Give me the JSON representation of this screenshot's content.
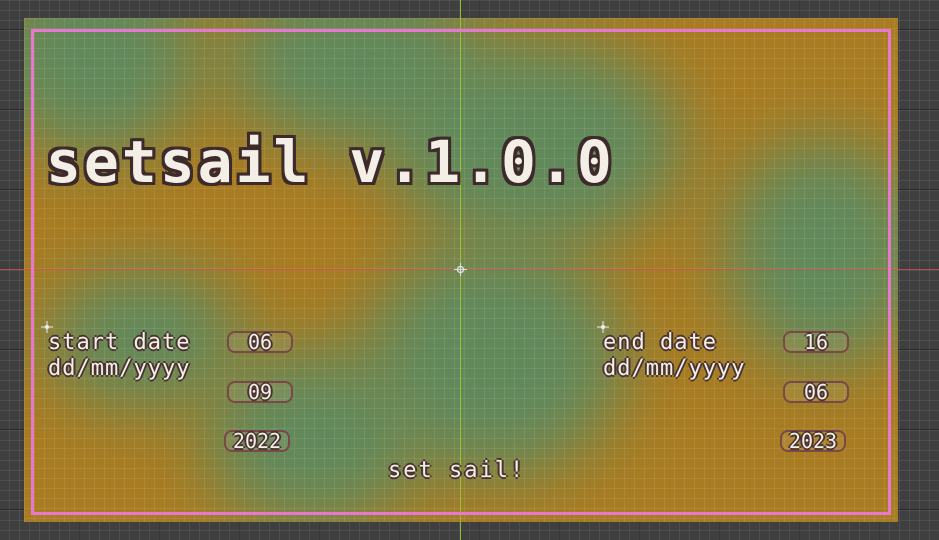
{
  "app": {
    "title": "setsail v.1.0.0"
  },
  "start_date": {
    "label": "start date",
    "format": "dd/mm/yyyy",
    "day": "06",
    "month": "09",
    "year": "2022"
  },
  "end_date": {
    "label": "end date",
    "format": "dd/mm/yyyy",
    "day": "16",
    "month": "06",
    "year": "2023"
  },
  "action": {
    "submit_label": "set sail!"
  },
  "colors": {
    "background_orange": "#a87c22",
    "background_green": "#5f8a5e",
    "frame_pink": "#e877d0",
    "axis_green": "#9ccc2e",
    "axis_red": "#d4524f",
    "text": "#f4efe6",
    "field_border": "#7a4848"
  }
}
